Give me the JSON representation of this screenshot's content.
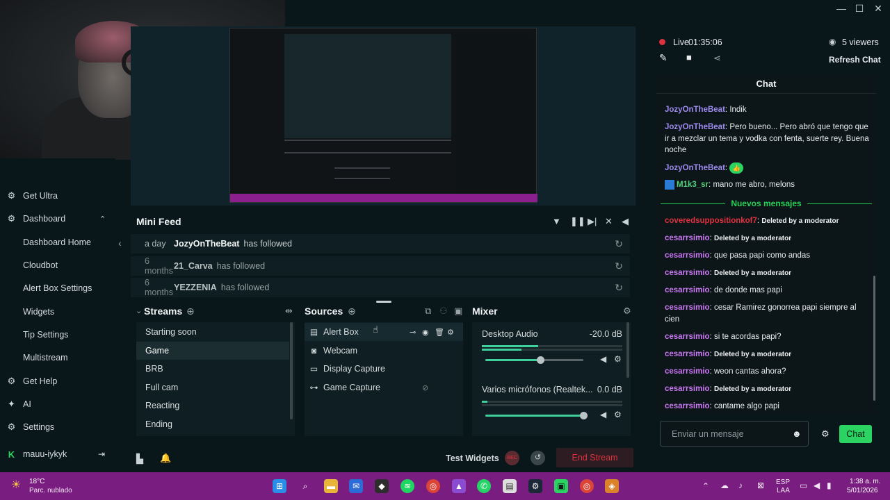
{
  "window": {
    "minimize": "—",
    "maximize": "☐",
    "close": "✕"
  },
  "sidebar": {
    "items": [
      {
        "label": "Get Ultra",
        "icon": "ultra-icon"
      },
      {
        "label": "Dashboard",
        "icon": "dashboard-icon",
        "expand": "⌃"
      },
      {
        "label": "Dashboard Home"
      },
      {
        "label": "Cloudbot"
      },
      {
        "label": "Alert Box Settings"
      },
      {
        "label": "Widgets"
      },
      {
        "label": "Tip Settings"
      },
      {
        "label": "Multistream"
      },
      {
        "label": "Get Help",
        "icon": "help-icon"
      },
      {
        "label": "AI",
        "icon": "ai-icon"
      },
      {
        "label": "Settings",
        "icon": "settings-icon"
      }
    ],
    "user": "mauu-iykyk",
    "collapse": "‹"
  },
  "minifeed": {
    "title": "Mini Feed",
    "rows": [
      {
        "time": "a day",
        "name": "JozyOnTheBeat",
        "action": "has followed"
      },
      {
        "time": "6 months",
        "name": "21_Carva",
        "action": "has followed"
      },
      {
        "time": "6 months",
        "name": "YEZZENIA",
        "action": "has followed"
      }
    ]
  },
  "scenes": {
    "title": "Streams",
    "items": [
      "Starting soon",
      "Game",
      "BRB",
      "Full cam",
      "Reacting",
      "Ending"
    ],
    "active": "Game"
  },
  "sources": {
    "title": "Sources",
    "items": [
      {
        "label": "Alert Box",
        "icon": "alert-box-icon"
      },
      {
        "label": "Webcam",
        "icon": "webcam-icon"
      },
      {
        "label": "Display Capture",
        "icon": "monitor-icon"
      },
      {
        "label": "Game Capture",
        "icon": "gamepad-icon"
      }
    ]
  },
  "mixer": {
    "title": "Mixer",
    "channels": [
      {
        "label": "Desktop Audio",
        "db": "-20.0 dB",
        "level": 0.56
      },
      {
        "label": "Varios micrófonos (Realtek...",
        "db": "0.0 dB",
        "level": 1.0
      }
    ]
  },
  "bottombar": {
    "test_widgets": "Test Widgets",
    "rec": "REC",
    "end_stream": "End Stream"
  },
  "stream_status": {
    "live": "Live",
    "time": "01:35:06",
    "viewers": "5 viewers",
    "refresh": "Refresh Chat"
  },
  "chat": {
    "title": "Chat",
    "new_messages_label": "Nuevos mensajes",
    "input_placeholder": "Enviar un mensaje",
    "send": "Chat",
    "messages": [
      {
        "user": "JozyOnTheBeat",
        "text": "Indik"
      },
      {
        "user": "JozyOnTheBeat",
        "text": "Pero bueno... Pero abró que tengo que ir a mezclar un tema y vodka con fenta, suerte rey. Buena noche"
      },
      {
        "user": "JozyOnTheBeat",
        "text": "👍"
      },
      {
        "user": "M1k3_sr",
        "text": "mano me abro, melons"
      },
      {
        "user": "coveredsuppositionkof7",
        "text": "Deleted by a moderator"
      },
      {
        "user": "cesarrsimio",
        "text": "Deleted by a moderator"
      },
      {
        "user": "cesarrsimio",
        "text": "que pasa papi como andas"
      },
      {
        "user": "cesarrsimio",
        "text": "Deleted by a moderator"
      },
      {
        "user": "cesarrsimio",
        "text": "de donde mas papi"
      },
      {
        "user": "cesarrsimio",
        "text": "cesar Ramirez gonorrea papi siempre al cien"
      },
      {
        "user": "cesarrsimio",
        "text": "si te acordas papi?"
      },
      {
        "user": "cesarrsimio",
        "text": "Deleted by a moderator"
      },
      {
        "user": "cesarrsimio",
        "text": "weon cantas ahora?"
      },
      {
        "user": "cesarrsimio",
        "text": "Deleted by a moderator"
      },
      {
        "user": "cesarrsimio",
        "text": "cantame algo papi"
      }
    ]
  },
  "taskbar": {
    "weather_temp": "18°C",
    "weather_desc": "Parc. nublado",
    "lang": "ESP",
    "lang2": "LAA",
    "time": "1:38 a. m.",
    "date": "5/01/2026"
  },
  "colors": {
    "accent": "#2bd462",
    "brand_green": "#3fcf9d",
    "taskbar": "#7a1d80",
    "end_stream": "#e0313f"
  }
}
